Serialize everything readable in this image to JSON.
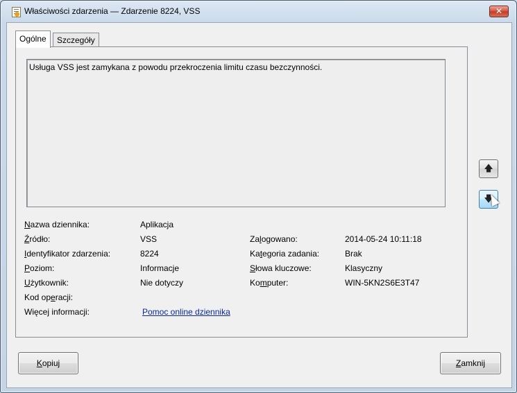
{
  "window": {
    "title": "Właściwości zdarzenia — Zdarzenie 8224, VSS",
    "close_label": "✕"
  },
  "tabs": [
    {
      "label": "Ogólne",
      "active": true
    },
    {
      "label": "Szczegóły",
      "active": false
    }
  ],
  "general": {
    "description": "Usługa VSS jest zamykana z powodu przekroczenia limitu czasu bezczynności.",
    "fields": {
      "log_name": {
        "label_u": "N",
        "label_rest": "azwa dziennika:",
        "value": "Aplikacja"
      },
      "source": {
        "label_u": "Ź",
        "label_rest": "ródło:",
        "value": "VSS"
      },
      "event_id": {
        "label_u": "I",
        "label_rest": "dentyfikator zdarzenia:",
        "value": "8224"
      },
      "level": {
        "label_u": "P",
        "label_rest": "oziom:",
        "value": "Informacje"
      },
      "user": {
        "label_u": "U",
        "label_rest": "żytkownik:",
        "value": "Nie dotyczy"
      },
      "opcode": {
        "label_pre": "Kod op",
        "label_u": "e",
        "label_rest": "racji:",
        "value": ""
      },
      "more_info": {
        "label": "Więcej informacji:",
        "link": "Pomoc online dziennika"
      },
      "logged": {
        "label_pre": "Za",
        "label_u": "l",
        "label_rest": "ogowano:",
        "value": "2014-05-24 10:11:18"
      },
      "task_category": {
        "label_pre": "Ka",
        "label_u": "t",
        "label_rest": "egoria zadania:",
        "value": "Brak"
      },
      "keywords": {
        "label_u": "S",
        "label_rest": "łowa kluczowe:",
        "value": "Klasyczny"
      },
      "computer": {
        "label_pre": "Ko",
        "label_u": "m",
        "label_rest": "puter:",
        "value": "WIN-5KN2S6E3T47"
      }
    }
  },
  "nav": {
    "up_icon": "arrow-up-icon",
    "down_icon": "arrow-down-icon",
    "up_glyph": "🡅",
    "down_glyph": "🡇"
  },
  "buttons": {
    "copy_u": "K",
    "copy_rest": "opiuj",
    "close_u": "Z",
    "close_rest": "amknij"
  }
}
